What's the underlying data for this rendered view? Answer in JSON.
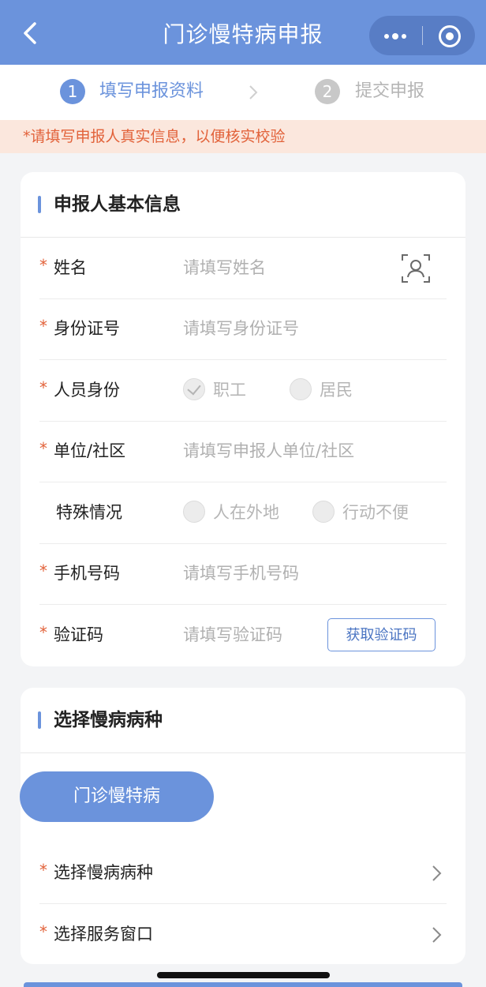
{
  "nav": {
    "title": "门诊慢特病申报"
  },
  "steps": [
    {
      "num": "1",
      "label": "填写申报资料"
    },
    {
      "num": "2",
      "label": "提交申报"
    }
  ],
  "notice": "*请填写申报人真实信息，以便核实校验",
  "applicant": {
    "section_title": "申报人基本信息",
    "required_mark": "*",
    "name": {
      "label": "姓名",
      "placeholder": "请填写姓名"
    },
    "id_number": {
      "label": "身份证号",
      "placeholder": "请填写身份证号"
    },
    "identity": {
      "label": "人员身份",
      "options": [
        "职工",
        "居民"
      ],
      "selected": "职工"
    },
    "unit": {
      "label": "单位/社区",
      "placeholder": "请填写申报人单位/社区"
    },
    "special": {
      "label": "特殊情况",
      "options": [
        "人在外地",
        "行动不便"
      ]
    },
    "phone": {
      "label": "手机号码",
      "placeholder": "请填写手机号码"
    },
    "code": {
      "label": "验证码",
      "placeholder": "请填写验证码",
      "button": "获取验证码"
    }
  },
  "disease": {
    "section_title": "选择慢病病种",
    "chip": "门诊慢特病",
    "required_mark": "*",
    "select_disease": "选择慢病病种",
    "select_window": "选择服务窗口"
  },
  "colors": {
    "primary": "#6b93dc",
    "warning": "#e2623a",
    "notice_bg": "#fbe7dd"
  }
}
